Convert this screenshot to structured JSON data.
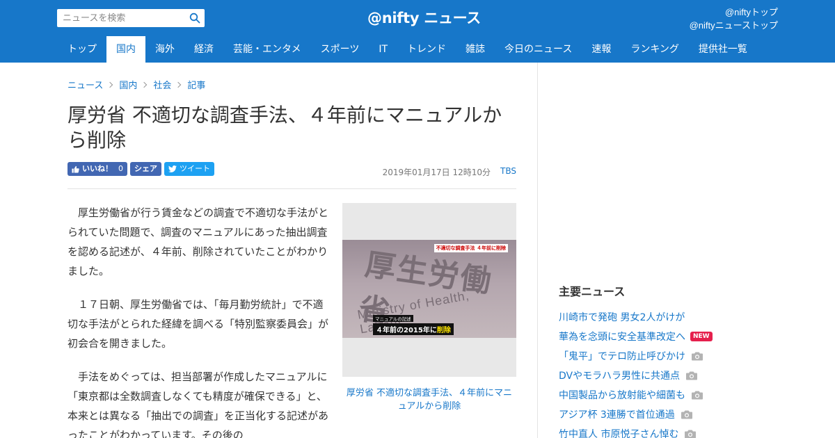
{
  "header": {
    "search_placeholder": "ニュースを検索",
    "logo": "@nifty ニュース",
    "links": [
      "@niftyトップ",
      "@niftyニューストップ"
    ],
    "brand_color": "#1777c9"
  },
  "nav": {
    "tabs": [
      "トップ",
      "国内",
      "海外",
      "経済",
      "芸能・エンタメ",
      "スポーツ",
      "IT",
      "トレンド",
      "雑誌",
      "今日のニュース",
      "速報",
      "ランキング",
      "提供社一覧"
    ],
    "active": "国内"
  },
  "breadcrumb": [
    "ニュース",
    "国内",
    "社会",
    "記事"
  ],
  "article": {
    "title": "厚労省 不適切な調査手法、４年前にマニュアルから削除",
    "social": {
      "like_label": "いいね！",
      "like_count": "0",
      "share_label": "シェア",
      "tweet_label": "ツイート"
    },
    "date": "2019年01月17日 12時10分",
    "source": "TBS",
    "paragraphs": [
      "厚生労働省が行う賃金などの調査で不適切な手法がとられていた問題で、調査のマニュアルにあった抽出調査を認める記述が、４年前、削除されていたことがわかりました。",
      "１７日朝、厚生労働省では、「毎月勤労統計」で不適切な手法がとられた経緯を調べる「特別監察委員会」が初会合を開きました。",
      "手法をめぐっては、担当部署が作成したマニュアルに「東京都は全数調査しなくても精度が確保できる」と、本来とは異なる「抽出での調査」を正当化する記述があったことがわかっています。その後の"
    ],
    "image": {
      "sign_kanji": "厚生労働省",
      "sign_english": "Ministry of Health, Labour",
      "caption_top": "不適切な調査手法 ４年前に削除",
      "caption_small": "マニュアルの記述",
      "caption_main_prefix": "４年前の2015年に",
      "caption_main_highlight": "削除"
    },
    "figure_caption": "厚労省 不適切な調査手法、４年前にマニュアルから削除"
  },
  "sidebar": {
    "heading": "主要ニュース",
    "items": [
      {
        "text": "川崎市で発砲 男女2人がけが",
        "badge": "",
        "icon": ""
      },
      {
        "text": "華為を念頭に安全基準改定へ",
        "badge": "NEW",
        "icon": ""
      },
      {
        "text": "「鬼平」でテロ防止呼びかけ",
        "badge": "",
        "icon": "camera-icon"
      },
      {
        "text": "DVやモラハラ男性に共通点",
        "badge": "",
        "icon": "camera-icon"
      },
      {
        "text": "中国製品から放射能や細菌も",
        "badge": "",
        "icon": "camera-icon"
      },
      {
        "text": "アジア杯 3連勝で首位通過",
        "badge": "",
        "icon": "camera-icon"
      },
      {
        "text": "竹中直人 市原悦子さん悼む",
        "badge": "",
        "icon": "camera-icon"
      }
    ]
  }
}
